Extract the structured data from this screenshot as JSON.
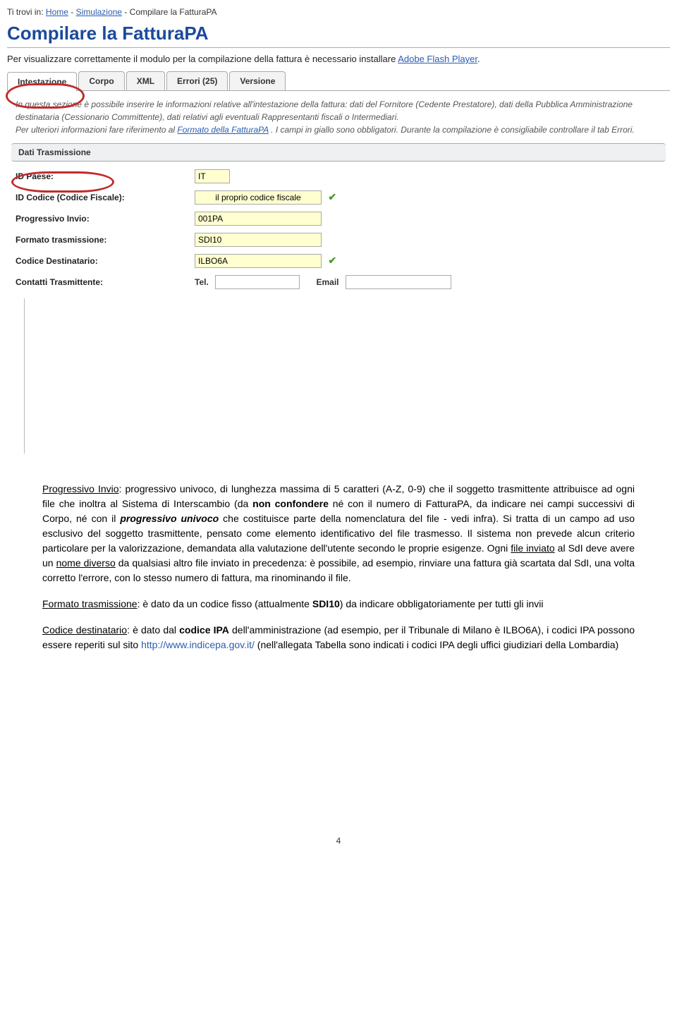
{
  "breadcrumb": {
    "prefix": "Ti trovi in: ",
    "home": "Home",
    "sep": " - ",
    "sim": "Simulazione",
    "current": "Compilare la FatturaPA"
  },
  "page_title": "Compilare la FatturaPA",
  "install_line": {
    "text": "Per visualizzare correttamente il modulo per la compilazione della fattura è necessario installare ",
    "link": "Adobe Flash Player",
    "suffix": "."
  },
  "tabs": {
    "t1": "Intestazione",
    "t2": "Corpo",
    "t3": "XML",
    "t4": "Errori (25)",
    "t5": "Versione"
  },
  "section_desc": {
    "line1": "In questa sezione è possibile inserire le informazioni relative all'intestazione della fattura: dati del Fornitore (Cedente Prestatore), dati della Pubblica Amministrazione destinataria (Cessionario Committente), dati relativi agli eventuali Rappresentanti fiscali o Intermediari.",
    "line2a": "Per ulteriori informazioni fare riferimento al ",
    "line2link": "Formato della FatturaPA",
    "line2b": ". I campi in giallo sono obbligatori. Durante la compilazione è consigliabile controllare il tab Errori."
  },
  "section_header": "Dati Trasmissione",
  "form": {
    "id_paese_lbl": "ID Paese:",
    "id_paese_val": "IT",
    "id_codice_lbl": "ID Codice (Codice Fiscale):",
    "id_codice_val": "il proprio codice fiscale",
    "progressivo_lbl": "Progressivo Invio:",
    "progressivo_val": "001PA",
    "formato_lbl": "Formato trasmissione:",
    "formato_val": "SDI10",
    "cod_dest_lbl": "Codice Destinatario:",
    "cod_dest_val": "ILBO6A",
    "contatti_lbl": "Contatti Trasmittente:",
    "tel_lbl": "Tel.",
    "email_lbl": "Email"
  },
  "body": {
    "p1_a": "Progressivo Invio",
    "p1_b": ": progressivo univoco, di lunghezza massima di 5 caratteri (A-Z, 0-9) che il soggetto trasmittente attribuisce ad ogni file che inoltra al Sistema di Interscambio (da ",
    "p1_c": "non confondere",
    "p1_d": " né con il numero di FatturaPA, da indicare nei campi successivi di Corpo, né con il ",
    "p1_e": "progressivo univoco",
    "p1_f": " che costituisce parte della nomenclatura del file - vedi infra). Si tratta di un campo ad uso esclusivo del soggetto trasmittente, pensato come elemento identificativo del file trasmesso. Il sistema non prevede alcun criterio particolare per la valorizzazione, demandata alla valutazione dell'utente secondo le proprie esigenze. Ogni ",
    "p1_g": "file inviato",
    "p1_h": " al SdI deve avere un ",
    "p1_i": "nome diverso",
    "p1_j": " da qualsiasi altro file inviato in precedenza: è  possibile, ad esempio, rinviare una fattura già scartata dal SdI, una volta corretto l'errore, con lo stesso numero di fattura, ma rinominando il file.",
    "p2_a": "Formato trasmissione",
    "p2_b": ": è dato da un codice fisso (attualmente ",
    "p2_c": "SDI10",
    "p2_d": ") da indicare obbligatoriamente per tutti gli invii",
    "p3_a": "Codice destinatario",
    "p3_b": ": è dato dal ",
    "p3_c": "codice IPA",
    "p3_d": " dell'amministrazione (ad esempio, per il Tribunale di Milano è ILBO6A), i codici IPA possono essere reperiti sul sito ",
    "p3_link": "http://www.indicepa.gov.it/",
    "p3_e": " (nell'allegata Tabella sono indicati i codici IPA degli uffici giudiziari della Lombardia)"
  },
  "page_number": "4"
}
